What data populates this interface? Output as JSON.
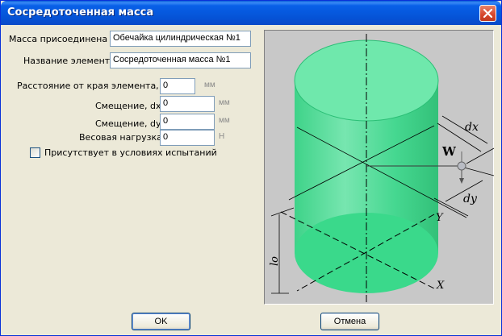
{
  "window": {
    "title": "Сосредоточенная масса"
  },
  "form": {
    "attached_to_label": "Масса присоединена к:",
    "attached_to_value": "Обечайка цилиндрическая №1",
    "element_name_label": "Название элемента:",
    "element_name_value": "Сосредоточенная масса №1",
    "distance_label": "Расстояние от края элемента, lo:",
    "distance_value": "0",
    "distance_unit": "мм",
    "offset_dx_label": "Смещение, dx:",
    "offset_dx_value": "0",
    "offset_dx_unit": "мм",
    "offset_dy_label": "Смещение, dy:",
    "offset_dy_value": "0",
    "offset_dy_unit": "мм",
    "weight_label": "Весовая нагрузка:",
    "weight_value": "0",
    "weight_unit": "Н",
    "test_condition_label": "Присутствует в условиях испытаний",
    "test_condition_checked": false
  },
  "diagram": {
    "label_w": "W",
    "label_dx": "dx",
    "label_dy": "dy",
    "label_y": "Y",
    "label_x": "X",
    "label_lo": "lo"
  },
  "buttons": {
    "ok": "OK",
    "cancel": "Отмена"
  },
  "colors": {
    "cylinder_fill": "#33dd88",
    "title_bar": "#0553d6"
  }
}
